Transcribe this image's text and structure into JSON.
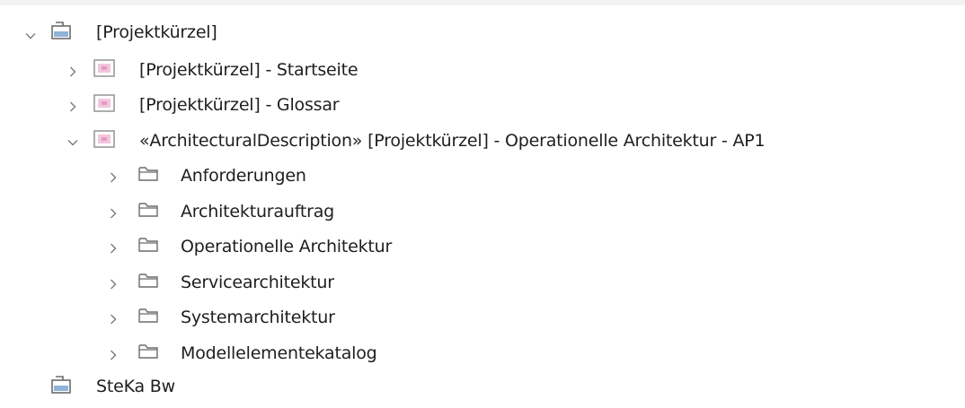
{
  "tree": {
    "root": {
      "label": "[Projektkürzel]",
      "expanded": true,
      "icon": "package-icon"
    },
    "children": [
      {
        "label": "[Projektkürzel] - Startseite",
        "expanded": false,
        "icon": "model-view-icon"
      },
      {
        "label": "[Projektkürzel] - Glossar",
        "expanded": false,
        "icon": "model-view-icon"
      },
      {
        "label": "«ArchitecturalDescription» [Projektkürzel] - Operationelle Architektur - AP1",
        "expanded": true,
        "icon": "model-view-icon",
        "children": [
          {
            "label": "Anforderungen",
            "expanded": false,
            "icon": "folder-icon"
          },
          {
            "label": "Architekturauftrag",
            "expanded": false,
            "icon": "folder-icon"
          },
          {
            "label": "Operationelle Architektur",
            "expanded": false,
            "icon": "folder-icon"
          },
          {
            "label": "Servicearchitektur",
            "expanded": false,
            "icon": "folder-icon"
          },
          {
            "label": "Systemarchitektur",
            "expanded": false,
            "icon": "folder-icon"
          },
          {
            "label": "Modellelementekatalog",
            "expanded": false,
            "icon": "folder-icon"
          }
        ]
      }
    ],
    "sibling_root": {
      "label": "SteKa Bw",
      "icon": "package-icon"
    }
  },
  "colors": {
    "chevron": "#7a7a7a",
    "folder_stroke": "#6b6b6b",
    "model_view_fill": "#f2c6dc",
    "model_view_stroke": "#9a9a9a",
    "package_body": "#8fb3d9"
  }
}
